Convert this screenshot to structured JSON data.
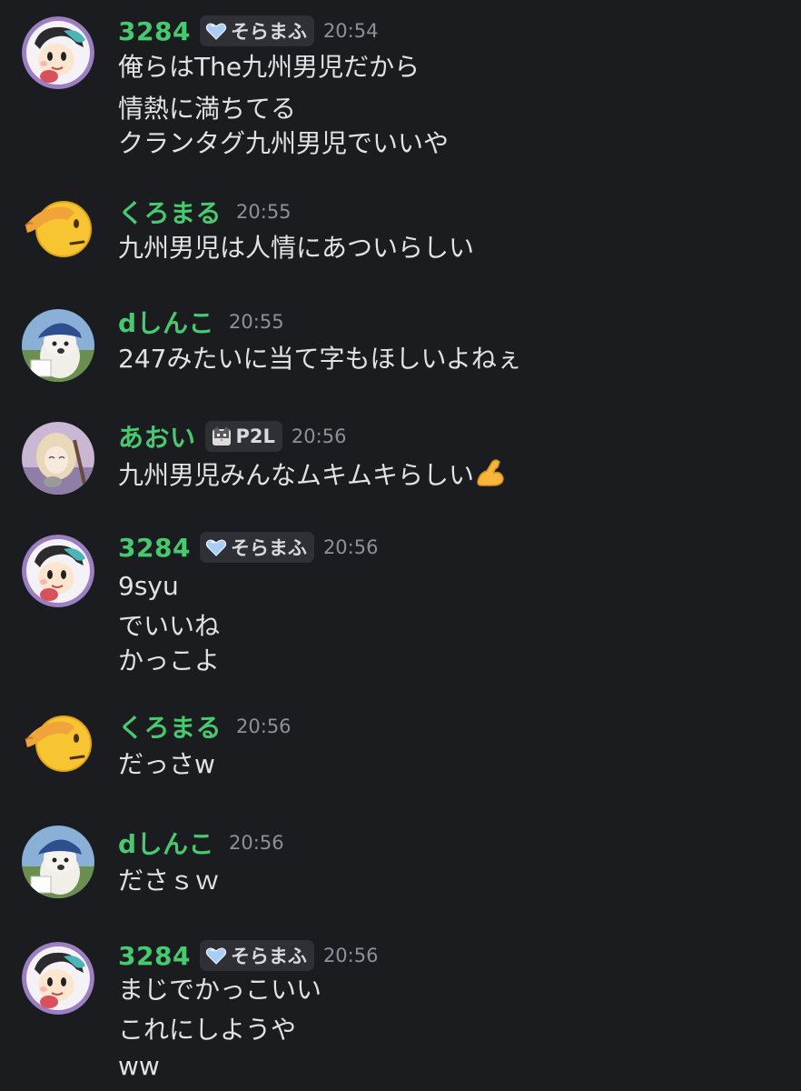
{
  "colors": {
    "background": "#1b1c20",
    "username": "#48c96f",
    "text": "#e1e2e6",
    "timestamp": "#8e9099",
    "tag_background": "#2e3036"
  },
  "messages": [
    {
      "username": "3284",
      "avatar": "3284-avatar",
      "tag": {
        "icon": "heart-icon",
        "label": "そらまふ"
      },
      "time": "20:54",
      "lines": [
        "俺らはThe九州男児だから",
        "情熱に満ちてる",
        "クランタグ九州男児でいいや"
      ]
    },
    {
      "username": "くろまる",
      "avatar": "saluting-face-emoji",
      "time": "20:55",
      "lines": [
        "九州男児は人情にあついらしい"
      ]
    },
    {
      "username": "dしんこ",
      "avatar": "dog-avatar",
      "time": "20:55",
      "lines": [
        "247みたいに当て字もほしいよねぇ"
      ]
    },
    {
      "username": "あおい",
      "avatar": "anime-girl-avatar",
      "tag": {
        "icon": "cat-icon",
        "label": "P2L"
      },
      "time": "20:56",
      "lines": [
        "九州男児みんなムキムキらしい"
      ],
      "trailing_emoji": "flexed-biceps-emoji"
    },
    {
      "username": "3284",
      "avatar": "3284-avatar",
      "tag": {
        "icon": "heart-icon",
        "label": "そらまふ"
      },
      "time": "20:56",
      "lines": [
        "9syu",
        "でいいね",
        "かっこよ"
      ]
    },
    {
      "username": "くろまる",
      "avatar": "saluting-face-emoji",
      "time": "20:56",
      "lines": [
        "だっさw"
      ]
    },
    {
      "username": "dしんこ",
      "avatar": "dog-avatar",
      "time": "20:56",
      "lines": [
        "ださｓｗ"
      ]
    },
    {
      "username": "3284",
      "avatar": "3284-avatar",
      "tag": {
        "icon": "heart-icon",
        "label": "そらまふ"
      },
      "time": "20:56",
      "lines": [
        "まじでかっこいい",
        "これにしようや",
        "ww"
      ]
    }
  ]
}
